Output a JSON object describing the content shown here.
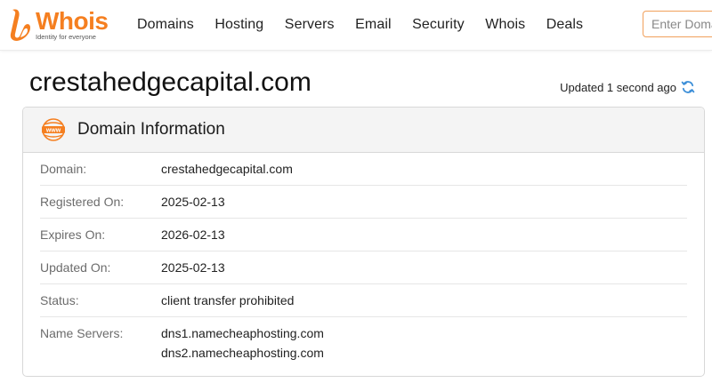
{
  "header": {
    "logo_text": "Whois",
    "logo_tagline": "Identity for everyone",
    "nav": [
      "Domains",
      "Hosting",
      "Servers",
      "Email",
      "Security",
      "Whois",
      "Deals"
    ],
    "search_placeholder": "Enter Domain"
  },
  "page": {
    "title": "crestahedgecapital.com",
    "updated": "Updated 1 second ago"
  },
  "card": {
    "title": "Domain Information",
    "icon_text": "www",
    "rows": [
      {
        "label": "Domain:",
        "value": "crestahedgecapital.com"
      },
      {
        "label": "Registered On:",
        "value": "2025-02-13"
      },
      {
        "label": "Expires On:",
        "value": "2026-02-13"
      },
      {
        "label": "Updated On:",
        "value": "2025-02-13"
      },
      {
        "label": "Status:",
        "value": "client transfer prohibited"
      },
      {
        "label": "Name Servers:",
        "values": [
          "dns1.namecheaphosting.com",
          "dns2.namecheaphosting.com"
        ]
      }
    ]
  },
  "colors": {
    "brand": "#f57f20",
    "refresh_icon": "#3d8fd8",
    "search_border": "#f1a05b"
  },
  "icons": {
    "logo": "whois-logo-icon",
    "refresh": "refresh-icon",
    "www": "www-globe-icon"
  }
}
